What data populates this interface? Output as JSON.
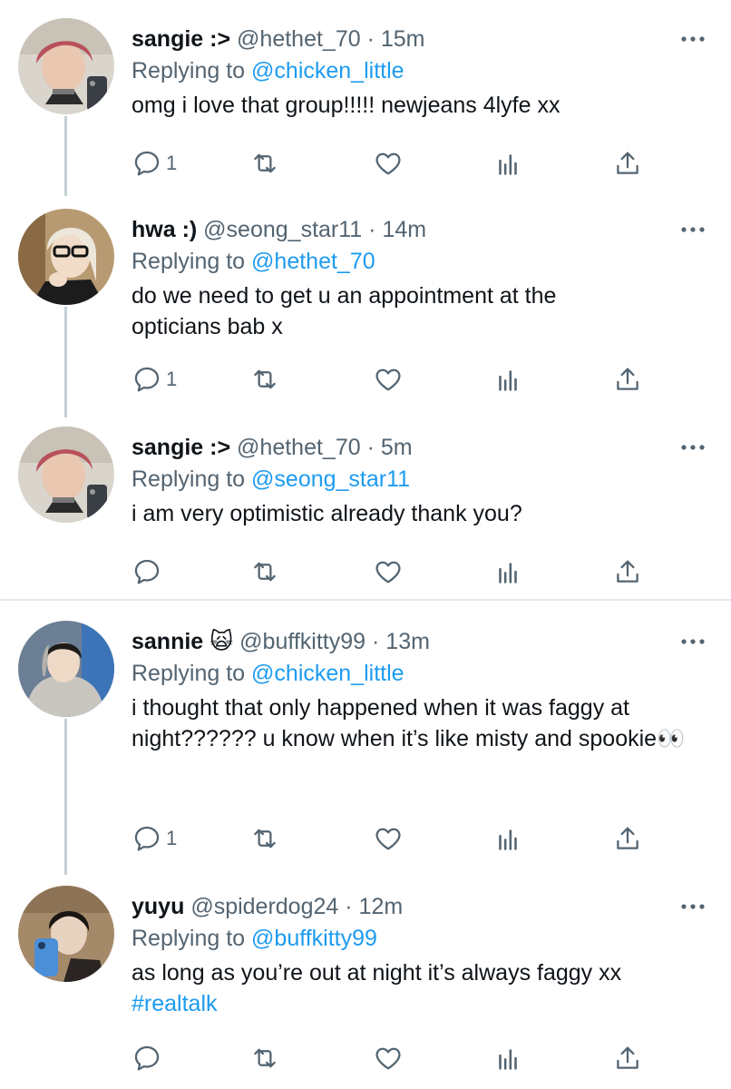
{
  "tweets": [
    {
      "name": "sangie :>",
      "handle": "@hethet_70",
      "time": "15m",
      "replying_label": "Replying to",
      "replying_to": "@chicken_little",
      "text": "omg i love that group!!!!! newjeans 4lyfe xx",
      "reply_count": "1"
    },
    {
      "name": "hwa :)",
      "handle": "@seong_star11",
      "time": "14m",
      "replying_label": "Replying to",
      "replying_to": "@hethet_70",
      "text": "do we need to get u an appointment at the opticians bab x",
      "reply_count": "1"
    },
    {
      "name": "sangie :>",
      "handle": "@hethet_70",
      "time": "5m",
      "replying_label": "Replying to",
      "replying_to": "@seong_star11",
      "text": "i am very optimistic already thank you?",
      "reply_count": ""
    },
    {
      "name": "sannie 🙀",
      "handle": "@buffkitty99",
      "time": "13m",
      "replying_label": "Replying to",
      "replying_to": "@chicken_little",
      "text": "i thought that only happened when it was faggy at night?????? u know when it’s like misty and spookie👀",
      "reply_count": "1"
    },
    {
      "name": "yuyu",
      "handle": "@spiderdog24",
      "time": "12m",
      "replying_label": "Replying to",
      "replying_to": "@buffkitty99",
      "text": "as long as you’re out at night it’s always faggy xx",
      "hashtag": "#realtalk",
      "reply_count": ""
    }
  ],
  "separator": "·",
  "icons": {
    "reply": "reply-icon",
    "retweet": "retweet-icon",
    "like": "like-icon",
    "analytics": "analytics-icon",
    "share": "share-icon",
    "more": "more-icon"
  },
  "colors": {
    "link": "#1d9bf0",
    "muted": "#536471",
    "thread_line": "#c4cfd6"
  }
}
